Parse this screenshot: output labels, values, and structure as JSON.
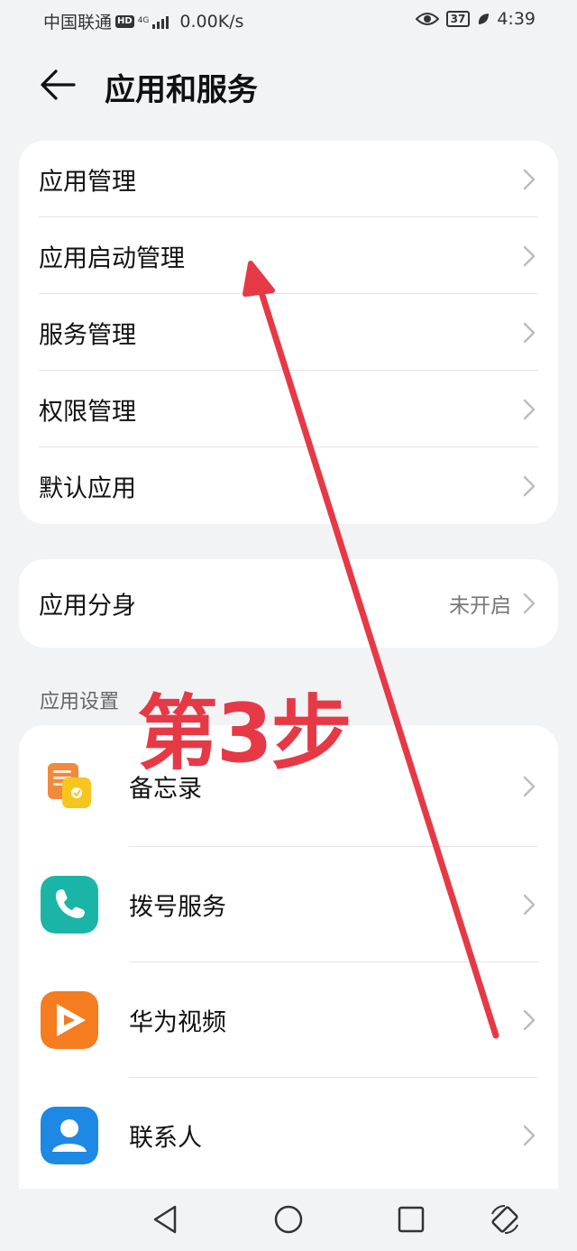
{
  "status_bar": {
    "carrier": "中国联通",
    "hd": "HD",
    "network": "4G",
    "speed": "0.00K/s",
    "battery": "37",
    "time": "4:39"
  },
  "header": {
    "title": "应用和服务"
  },
  "main_card": {
    "items": [
      {
        "label": "应用管理"
      },
      {
        "label": "应用启动管理"
      },
      {
        "label": "服务管理"
      },
      {
        "label": "权限管理"
      },
      {
        "label": "默认应用"
      }
    ]
  },
  "twin_card": {
    "label": "应用分身",
    "value": "未开启"
  },
  "app_settings": {
    "section_title": "应用设置",
    "apps": [
      {
        "label": "备忘录",
        "icon": "notepad-icon",
        "color": "#f5a623"
      },
      {
        "label": "拨号服务",
        "icon": "phone-icon",
        "color": "#1bb5a8"
      },
      {
        "label": "华为视频",
        "icon": "video-play-icon",
        "color": "#f57c1f"
      },
      {
        "label": "联系人",
        "icon": "contact-person-icon",
        "color": "#1e88e5"
      }
    ]
  },
  "annotation": {
    "step_text": "第3步",
    "color": "#e63946"
  }
}
